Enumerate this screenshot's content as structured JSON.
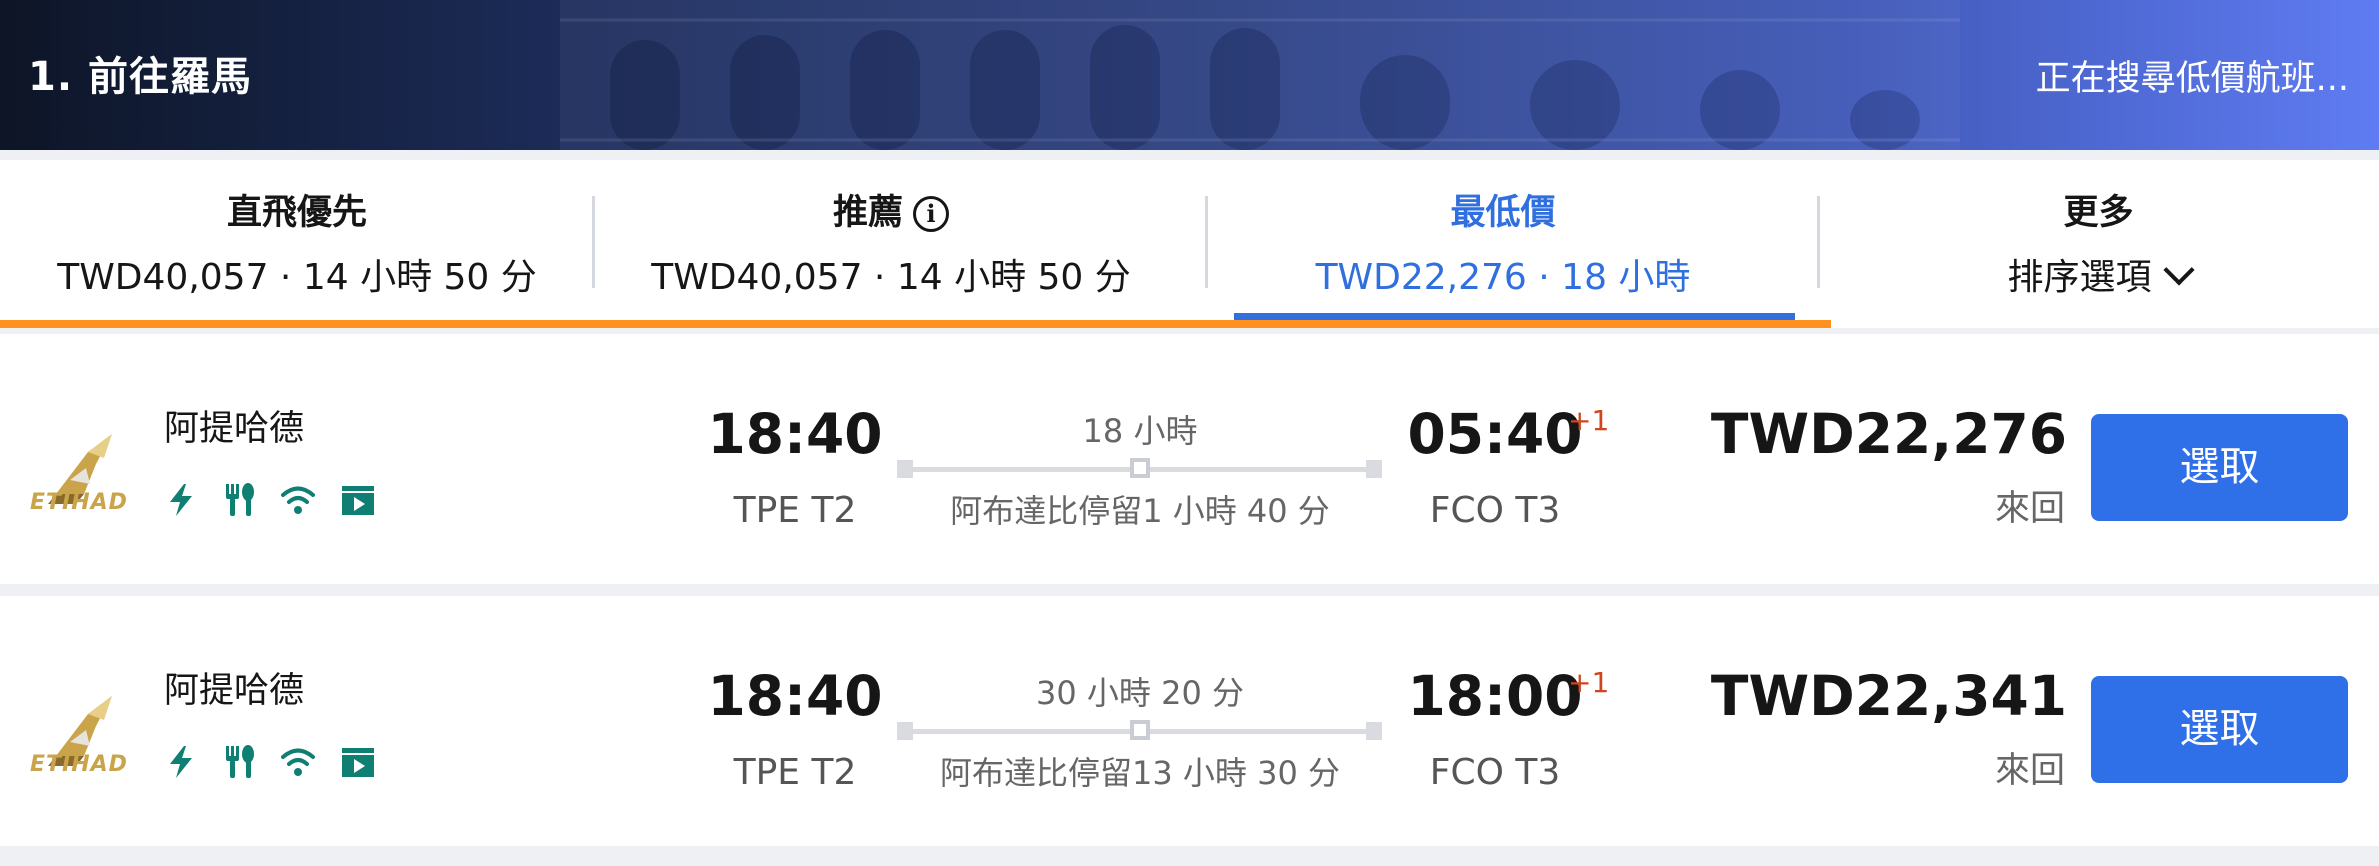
{
  "header": {
    "title": "1. 前往羅馬",
    "status": "正在搜尋低價航班..."
  },
  "tabs": [
    {
      "title": "直飛優先",
      "subtitle": "TWD40,057 · 14 小時 50 分"
    },
    {
      "title": "推薦",
      "subtitle": "TWD40,057 · 14 小時 50 分",
      "icon": "info-icon"
    },
    {
      "title": "最低價",
      "subtitle": "TWD22,276 · 18 小時",
      "active": true
    },
    {
      "title": "更多",
      "subtitle": "排序選項",
      "icon": "chevron-down-icon"
    }
  ],
  "colors": {
    "accent_blue": "#2f6fe0",
    "accent_orange": "#ff9120",
    "button_blue": "#2f6fe8",
    "amenity_teal": "#0f7f74",
    "day_offset_red": "#d1451b"
  },
  "flights": [
    {
      "airline": "阿提哈德",
      "logo_text": "ETIHAD",
      "amenities": [
        "power-icon",
        "meal-icon",
        "wifi-icon",
        "entertainment-icon"
      ],
      "depart_time": "18:40",
      "depart_airport": "TPE T2",
      "duration": "18 小時",
      "stopover": "阿布達比停留1 小時 40 分",
      "arrive_time": "05:40",
      "day_offset": "+1",
      "arrive_airport": "FCO T3",
      "price": "TWD22,276",
      "trip_type": "來回",
      "button": "選取"
    },
    {
      "airline": "阿提哈德",
      "logo_text": "ETIHAD",
      "amenities": [
        "power-icon",
        "meal-icon",
        "wifi-icon",
        "entertainment-icon"
      ],
      "depart_time": "18:40",
      "depart_airport": "TPE T2",
      "duration": "30 小時 20 分",
      "stopover": "阿布達比停留13 小時 30 分",
      "arrive_time": "18:00",
      "day_offset": "+1",
      "arrive_airport": "FCO T3",
      "price": "TWD22,341",
      "trip_type": "來回",
      "button": "選取"
    }
  ]
}
